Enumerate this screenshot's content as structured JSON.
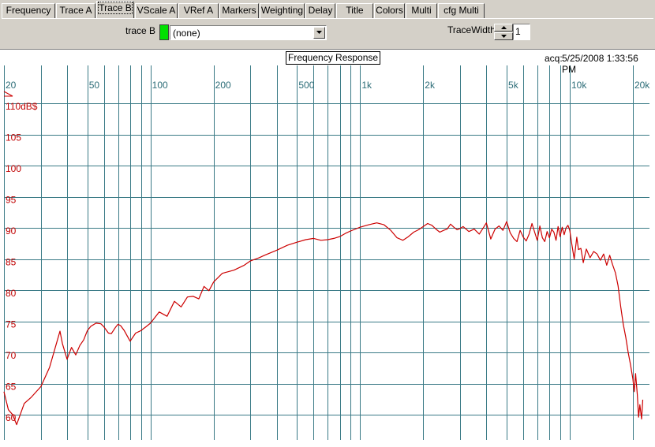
{
  "tabs": [
    {
      "label": "Frequency",
      "active": false
    },
    {
      "label": "Trace A",
      "active": false
    },
    {
      "label": "Trace B",
      "active": true
    },
    {
      "label": "VScale A",
      "active": false
    },
    {
      "label": "VRef A",
      "active": false
    },
    {
      "label": "Markers",
      "active": false
    },
    {
      "label": "Weighting",
      "active": false
    },
    {
      "label": "Delay",
      "active": false
    },
    {
      "label": "Title",
      "active": false
    },
    {
      "label": "Colors",
      "active": false
    },
    {
      "label": "Multi",
      "active": false
    },
    {
      "label": "cfg Multi",
      "active": false
    }
  ],
  "panel": {
    "trace_b_label": "trace B",
    "trace_b_color": "#00e000",
    "trace_select_value": "(none)",
    "trace_width_label": "TraceWidth",
    "trace_width_value": "1"
  },
  "colors": {
    "grid": "#3a7a86",
    "trace": "#cc0000",
    "x_tick_text": "#2d6d78",
    "y_tick_text": "#c00000"
  },
  "header": {
    "acq_label": "acq:",
    "acq_value": "5/25/2008 1:33:56 PM"
  },
  "chart_data": {
    "type": "line",
    "title": "Frequency Response",
    "xlabel": "",
    "ylabel": "",
    "x_scale": "log",
    "xlim": [
      20,
      24000
    ],
    "ylim": [
      57.5,
      110
    ],
    "grid": true,
    "x_tick_labels": [
      {
        "v": 20,
        "t": "20"
      },
      {
        "v": 50,
        "t": "50"
      },
      {
        "v": 100,
        "t": "100"
      },
      {
        "v": 200,
        "t": "200"
      },
      {
        "v": 500,
        "t": "500"
      },
      {
        "v": 1000,
        "t": "1k"
      },
      {
        "v": 2000,
        "t": "2k"
      },
      {
        "v": 5000,
        "t": "5k"
      },
      {
        "v": 10000,
        "t": "10k"
      },
      {
        "v": 20000,
        "t": "20k"
      }
    ],
    "x_grid": [
      20,
      30,
      40,
      50,
      60,
      70,
      80,
      90,
      100,
      200,
      300,
      400,
      500,
      600,
      700,
      800,
      900,
      1000,
      2000,
      3000,
      4000,
      5000,
      6000,
      7000,
      8000,
      9000,
      10000,
      20000
    ],
    "y_tick_labels": [
      {
        "v": 110,
        "t": "110dB$"
      },
      {
        "v": 105,
        "t": "105"
      },
      {
        "v": 100,
        "t": "100"
      },
      {
        "v": 95,
        "t": "95"
      },
      {
        "v": 90,
        "t": "90"
      },
      {
        "v": 85,
        "t": "85"
      },
      {
        "v": 80,
        "t": "80"
      },
      {
        "v": 75,
        "t": "75"
      },
      {
        "v": 70,
        "t": "70"
      },
      {
        "v": 65,
        "t": "65"
      },
      {
        "v": 60,
        "t": "60"
      }
    ],
    "series": [
      {
        "x": [
          20,
          21,
          22,
          23,
          25,
          27,
          30,
          33,
          35,
          37,
          38,
          40,
          42,
          44,
          46,
          48,
          50,
          52,
          55,
          58,
          60,
          63,
          65,
          68,
          70,
          72,
          75,
          80,
          85,
          90,
          95,
          100,
          110,
          120,
          130,
          140,
          150,
          160,
          170,
          180,
          190,
          200,
          220,
          250,
          280,
          300,
          330,
          350,
          400,
          450,
          500,
          550,
          600,
          650,
          700,
          750,
          800,
          850,
          900,
          1000,
          1100,
          1200,
          1300,
          1400,
          1500,
          1600,
          1700,
          1800,
          1900,
          2000,
          2100,
          2200,
          2300,
          2400,
          2500,
          2600,
          2700,
          2800,
          2900,
          3000,
          3100,
          3200,
          3300,
          3500,
          3700,
          3900,
          4000,
          4200,
          4400,
          4600,
          4800,
          5000,
          5200,
          5400,
          5600,
          5800,
          6000,
          6200,
          6400,
          6600,
          6800,
          7000,
          7200,
          7400,
          7600,
          7800,
          8000,
          8200,
          8400,
          8600,
          8800,
          9000,
          9200,
          9400,
          9600,
          9800,
          10000,
          10200,
          10500,
          10800,
          11000,
          11300,
          11600,
          12000,
          12500,
          13000,
          13500,
          14000,
          14500,
          15000,
          15500,
          16000,
          16500,
          17000,
          17500,
          18000,
          18500,
          19000,
          19500,
          20000,
          20300,
          20600,
          21000,
          21300,
          21600,
          22000,
          22300
        ],
        "y": [
          63.7,
          60.8,
          60.0,
          58.4,
          61.8,
          62.8,
          64.5,
          67.6,
          70.6,
          73.4,
          71.4,
          68.9,
          70.8,
          69.6,
          71.1,
          72.0,
          73.5,
          74.2,
          74.7,
          74.6,
          74.1,
          73.1,
          73.0,
          74.0,
          74.5,
          74.3,
          73.5,
          71.8,
          73.1,
          73.5,
          74.1,
          74.7,
          76.5,
          75.8,
          78.2,
          77.3,
          78.9,
          79.0,
          78.6,
          80.6,
          79.9,
          81.3,
          82.7,
          83.2,
          84.0,
          84.7,
          85.2,
          85.6,
          86.4,
          87.2,
          87.7,
          88.1,
          88.3,
          88.0,
          88.1,
          88.3,
          88.6,
          89.1,
          89.5,
          90.1,
          90.5,
          90.8,
          90.5,
          89.6,
          88.4,
          88.0,
          88.6,
          89.3,
          89.7,
          90.2,
          90.7,
          90.4,
          89.8,
          89.3,
          89.6,
          89.8,
          90.6,
          90.1,
          89.7,
          89.9,
          90.2,
          89.8,
          89.4,
          89.8,
          89.0,
          90.2,
          90.8,
          88.2,
          89.8,
          90.3,
          89.6,
          91.0,
          89.2,
          88.3,
          87.8,
          89.6,
          88.5,
          87.9,
          89.0,
          90.7,
          89.3,
          88.0,
          90.3,
          88.4,
          87.8,
          89.4,
          88.4,
          89.8,
          89.3,
          88.0,
          90.2,
          88.6,
          90.1,
          88.9,
          90.0,
          90.4,
          89.6,
          87.6,
          85.0,
          88.5,
          86.5,
          86.7,
          84.4,
          86.6,
          85.2,
          86.2,
          85.8,
          84.8,
          85.8,
          84.0,
          85.6,
          84.1,
          82.8,
          80.7,
          77.3,
          74.5,
          72.4,
          70.0,
          68.0,
          65.7,
          63.7,
          66.6,
          63.2,
          59.6,
          61.6,
          59.3,
          62.4
        ]
      }
    ]
  }
}
